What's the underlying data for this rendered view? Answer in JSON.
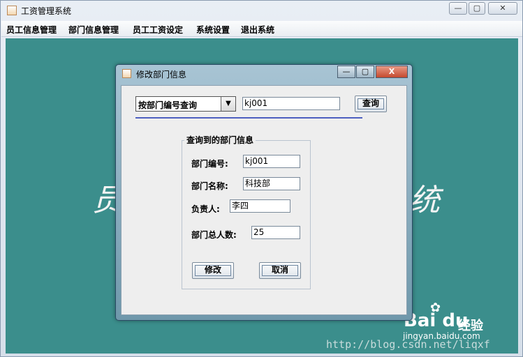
{
  "window": {
    "title": "工资管理系统",
    "controls": {
      "minimize": "—",
      "maximize": "▢",
      "close": "✕"
    }
  },
  "menu": [
    "员工信息管理",
    "部门信息管理",
    "员工工资设定",
    "系统设置",
    "退出系统"
  ],
  "background": {
    "glyph_left": "员",
    "glyph_right": "统",
    "watermark": "http://blog.csdn.net/liqxf",
    "baidu_logo": "Bai du",
    "baidu_product": "经验",
    "baidu_url": "jingyan.baidu.com"
  },
  "dialog": {
    "title": "修改部门信息",
    "controls": {
      "minimize": "—",
      "maximize": "▢",
      "close": "X"
    },
    "search": {
      "mode_selected": "按部门编号查询",
      "query_value": "kj001",
      "button_label": "查询"
    },
    "group_title": "查询到的部门信息",
    "fields": {
      "dept_id": {
        "label": "部门编号:",
        "value": "kj001"
      },
      "dept_name": {
        "label": "部门名称:",
        "value": "科技部"
      },
      "manager": {
        "label": "负责人:",
        "value": "李四"
      },
      "headcount": {
        "label": "部门总人数:",
        "value": "25"
      }
    },
    "buttons": {
      "modify": "修改",
      "cancel": "取消"
    }
  },
  "colors": {
    "desktop": "#3b8e8c",
    "divider": "#4d5fc0"
  }
}
